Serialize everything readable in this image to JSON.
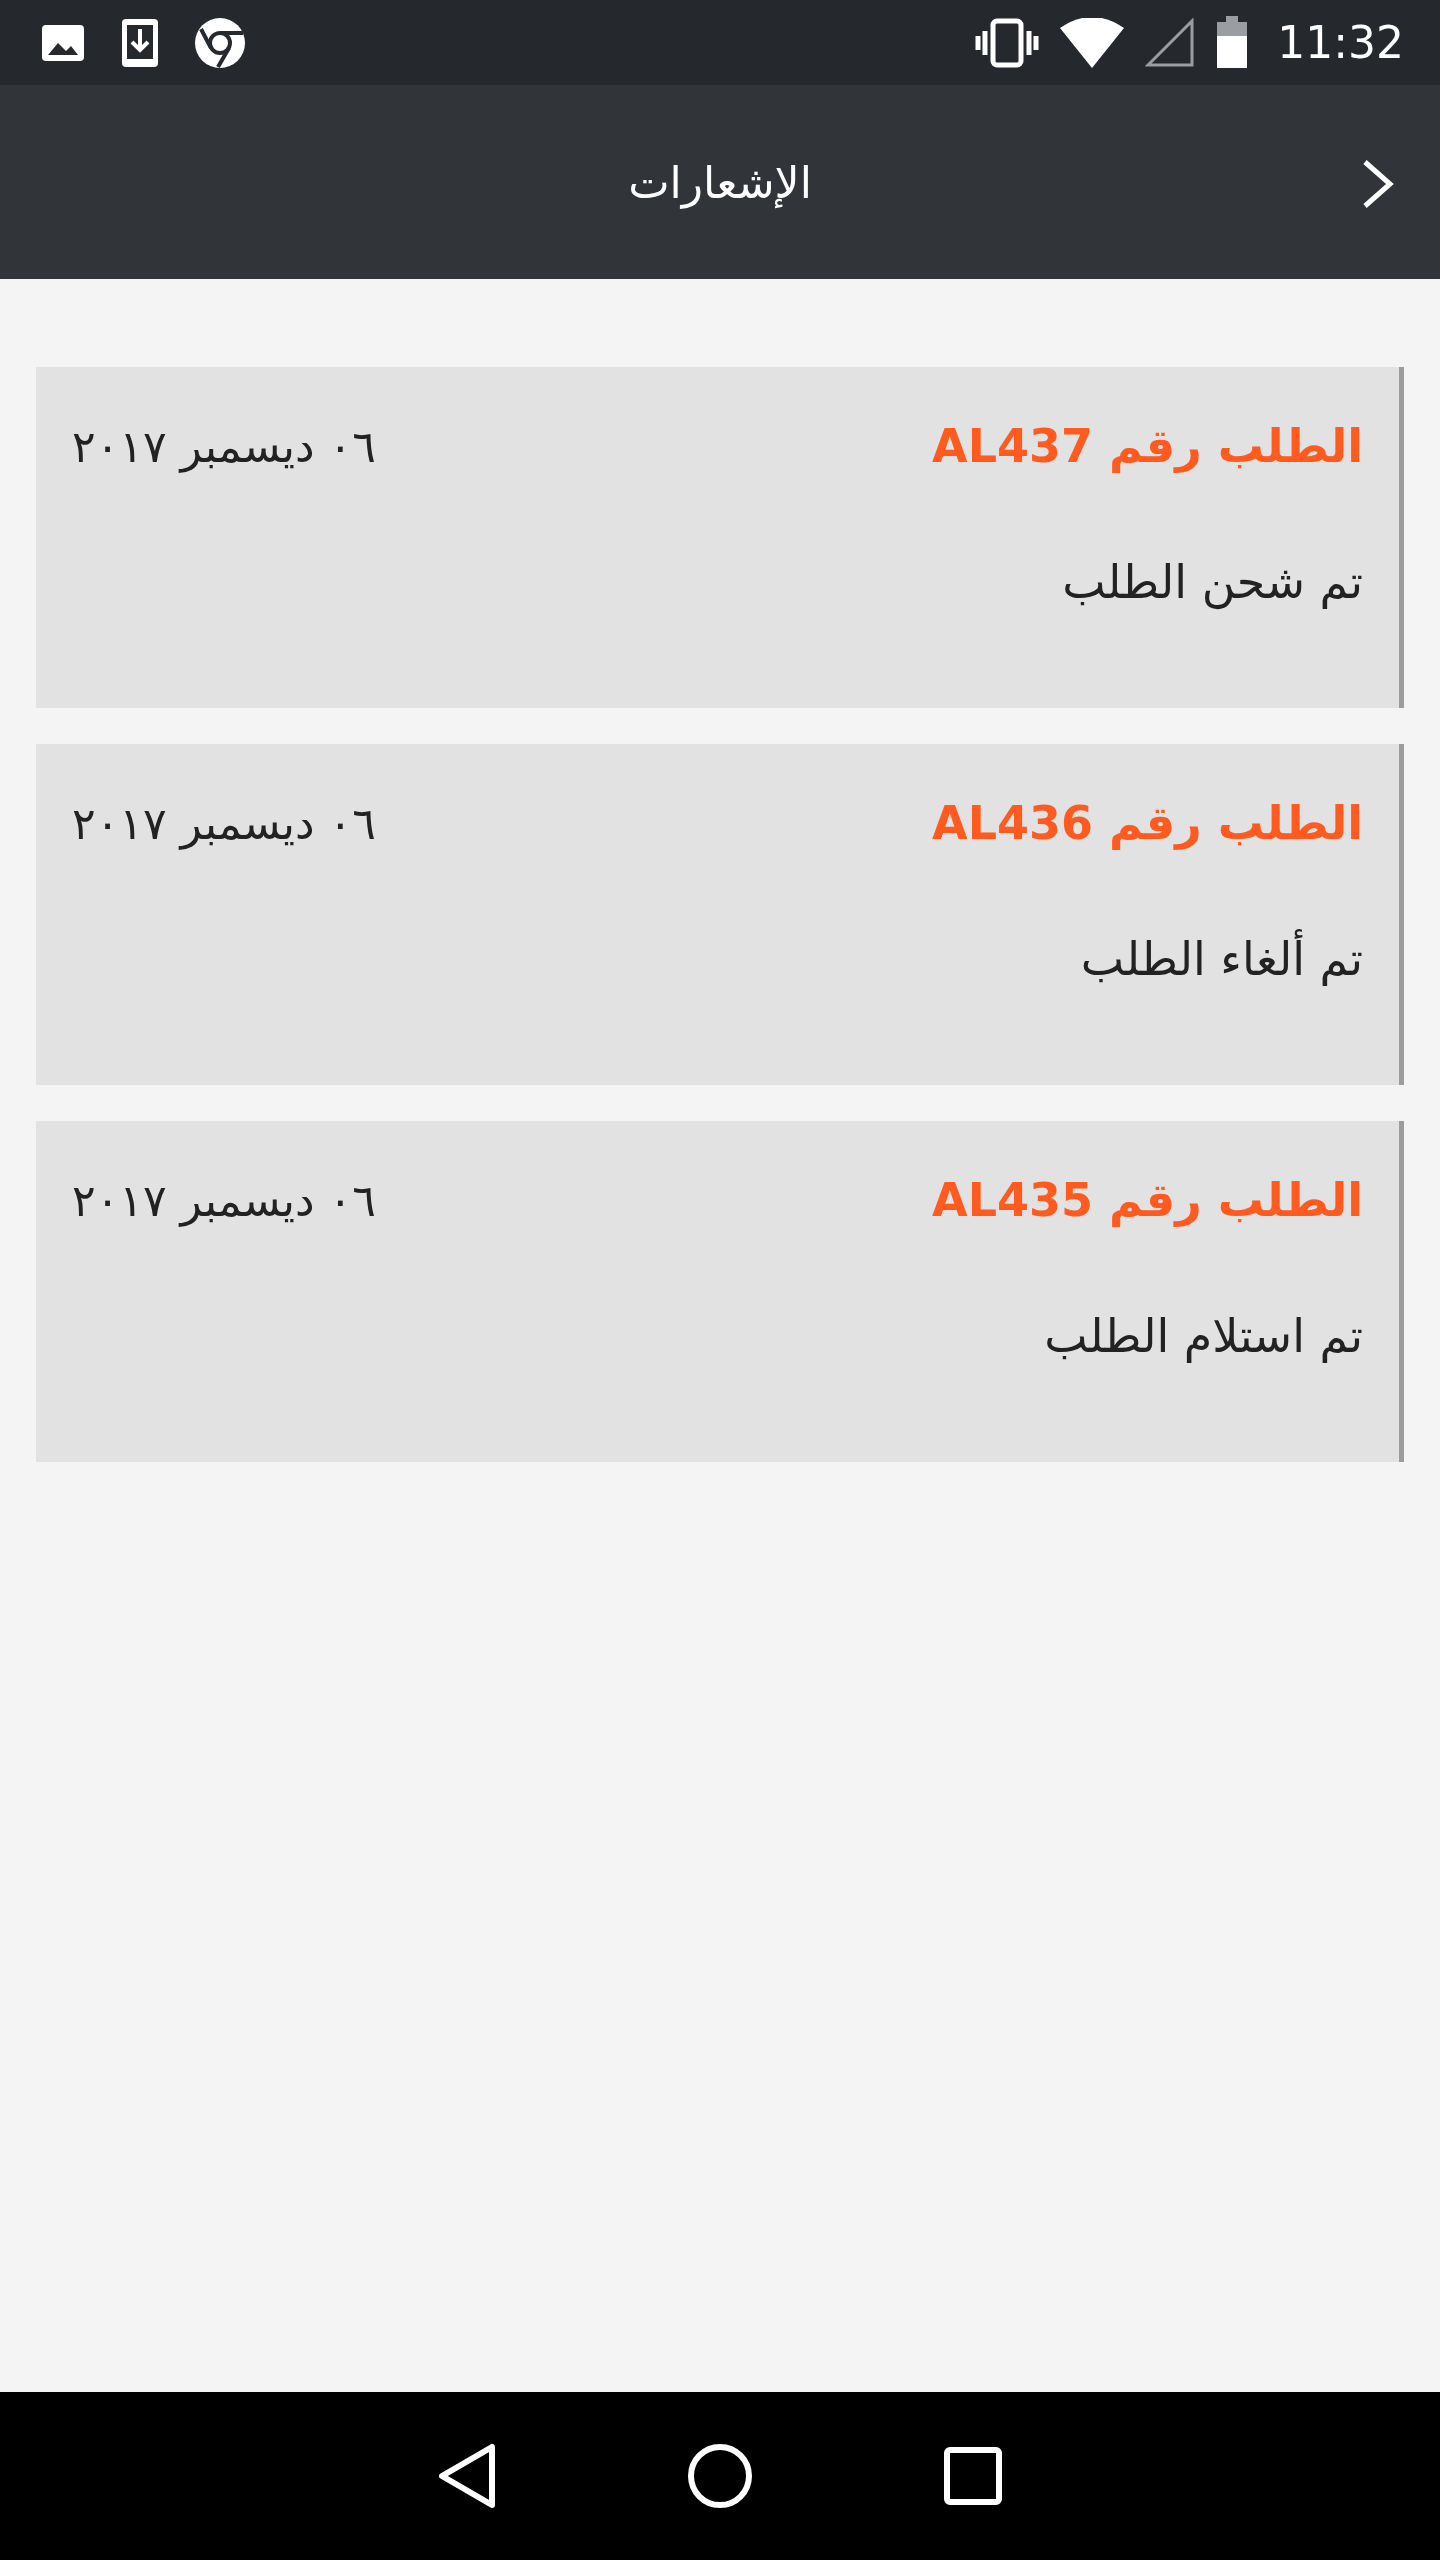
{
  "status_bar": {
    "time": "11:32"
  },
  "header": {
    "title": "الإشعارات"
  },
  "notifications": [
    {
      "title": "الطلب رقم AL437",
      "date": "٠٦ ديسمبر ٢٠١٧",
      "message": "تم شحن الطلب"
    },
    {
      "title": "الطلب رقم AL436",
      "date": "٠٦ ديسمبر ٢٠١٧",
      "message": "تم ألغاء الطلب"
    },
    {
      "title": "الطلب رقم AL435",
      "date": "٠٦ ديسمبر ٢٠١٧",
      "message": "تم استلام الطلب"
    }
  ]
}
